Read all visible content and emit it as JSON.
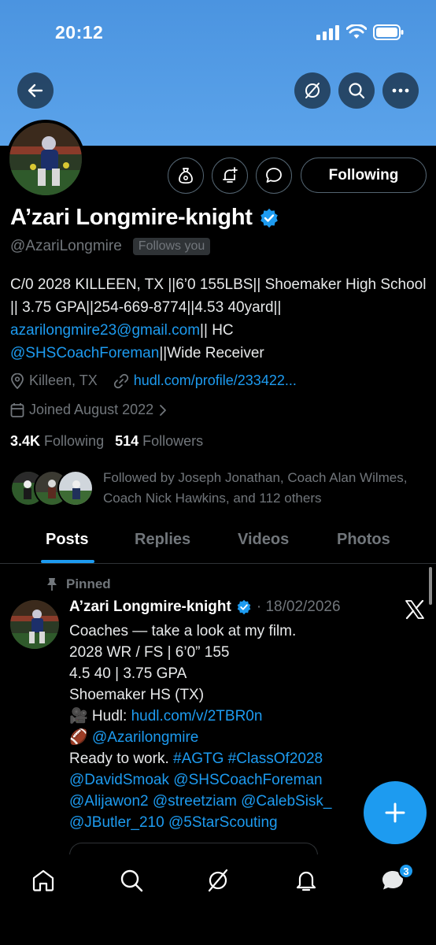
{
  "status_bar": {
    "time": "20:12"
  },
  "profile": {
    "name": "A’zari Longmire-knight",
    "handle": "@AzariLongmire",
    "follows_you": "Follows you",
    "following_button": "Following",
    "bio_line1": "C/0 2028 KILLEEN, TX ||6’0 155LBS|| Shoemaker High School || 3.75 GPA||254-669-8774||4.53 40yard||",
    "bio_email": "azarilongmire23@gmail.com",
    "bio_after_email": "|| HC",
    "bio_coach": "@SHSCoachForeman",
    "bio_end": "||Wide Receiver",
    "location": "Killeen, TX",
    "website": "hudl.com/profile/233422...",
    "joined": "Joined August 2022",
    "following_count": "3.4K",
    "following_label": "Following",
    "followers_count": "514",
    "followers_label": "Followers",
    "followed_by": "Followed by Joseph Jonathan, Coach Alan Wilmes, Coach Nick Hawkins, and 112 others"
  },
  "tabs": [
    {
      "label": "Posts"
    },
    {
      "label": "Replies"
    },
    {
      "label": "Videos"
    },
    {
      "label": "Photos"
    }
  ],
  "pinned_post": {
    "pinned_label": "Pinned",
    "author": "A’zari Longmire-knight",
    "date": "· 18/02/2026",
    "line1": "Coaches — take a look at my film.",
    "line2": "2028 WR / FS | 6’0” 155",
    "line3": "4.5 40 | 3.75 GPA",
    "line4": "Shoemaker HS (TX)",
    "hudl_prefix": "🎥 Hudl: ",
    "hudl_link": "hudl.com/v/2TBR0n",
    "helmet_prefix": "🏈 ",
    "helmet_link": "@Azarilongmire",
    "ready": "Ready to work. ",
    "hashtags": "#AGTG #ClassOf2028",
    "mentions1": "@DavidSmoak @SHSCoachForeman",
    "mentions2": "@Alijawon2 @streetziam @CalebSisk_",
    "mentions3": "@JButler_210 @5StarScouting"
  },
  "bottom_nav": {
    "messages_badge": "3"
  },
  "colors": {
    "accent": "#1d9bf0",
    "banner": "#5ba3ea",
    "background": "#000000",
    "muted": "#71767b"
  }
}
